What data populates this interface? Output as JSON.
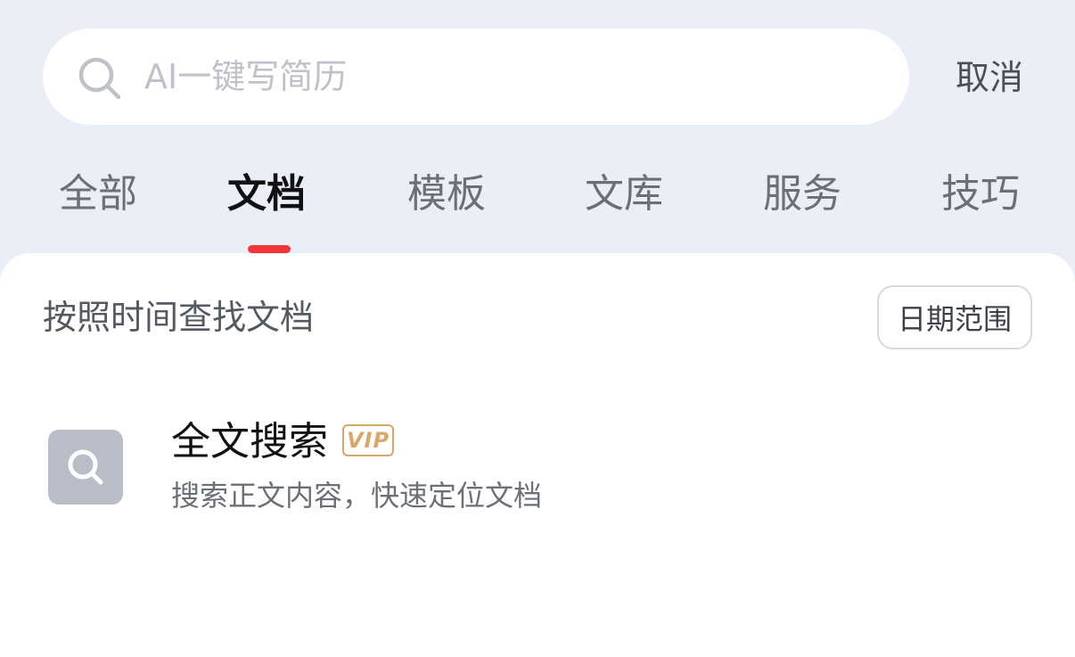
{
  "search": {
    "placeholder": "AI一键写简历",
    "value": "",
    "icon": "search-icon",
    "cancel_label": "取消"
  },
  "tabs": [
    {
      "label": "全部",
      "active": false
    },
    {
      "label": "文档",
      "active": true
    },
    {
      "label": "模板",
      "active": false
    },
    {
      "label": "文库",
      "active": false
    },
    {
      "label": "服务",
      "active": false
    },
    {
      "label": "技巧",
      "active": false
    }
  ],
  "filter": {
    "label": "按照时间查找文档",
    "date_range_label": "日期范围"
  },
  "feature": {
    "icon": "search-icon",
    "title": "全文搜索",
    "badge": "VIP",
    "description": "搜索正文内容，快速定位文档"
  },
  "colors": {
    "page_background": "#e9eef7",
    "active_tab_indicator": "#f0363a",
    "vip_badge": "#d9a766",
    "feature_icon_background": "#b9bdc8"
  }
}
